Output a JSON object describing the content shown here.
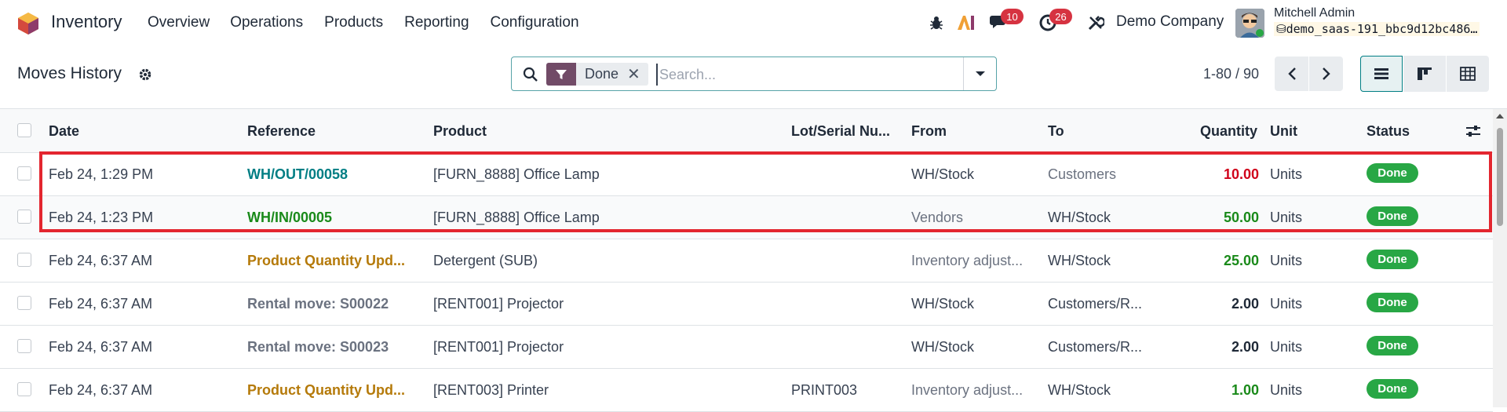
{
  "app": {
    "name": "Inventory"
  },
  "menu": [
    "Overview",
    "Operations",
    "Products",
    "Reporting",
    "Configuration"
  ],
  "systray": {
    "messages_badge": "10",
    "activities_badge": "26",
    "company": "Demo Company",
    "user_name": "Mitchell Admin",
    "db_name": "demo_saas-191_bbc9d12bc486…"
  },
  "page": {
    "title": "Moves History"
  },
  "search": {
    "facet": "Done",
    "placeholder": "Search..."
  },
  "pager": {
    "value": "1-80 / 90"
  },
  "columns": {
    "date": "Date",
    "reference": "Reference",
    "product": "Product",
    "lot": "Lot/Serial Nu...",
    "from": "From",
    "to": "To",
    "quantity": "Quantity",
    "unit": "Unit",
    "status": "Status"
  },
  "colors": {
    "accent": "#714b67",
    "teal": "#017e84",
    "done_green": "#28a745",
    "out_red": "#d0021b",
    "in_green": "#1a8a1a",
    "ref_blue": "#017e84",
    "ref_orange": "#b57a0a",
    "highlight": "#e3262f"
  },
  "rows": [
    {
      "date": "Feb 24, 1:29 PM",
      "reference": "WH/OUT/00058",
      "product": "[FURN_8888] Office Lamp",
      "lot": "",
      "from": "WH/Stock",
      "to": "Customers",
      "quantity": "10.00",
      "unit": "Units",
      "status": "Done"
    },
    {
      "date": "Feb 24, 1:23 PM",
      "reference": "WH/IN/00005",
      "product": "[FURN_8888] Office Lamp",
      "lot": "",
      "from": "Vendors",
      "to": "WH/Stock",
      "quantity": "50.00",
      "unit": "Units",
      "status": "Done"
    },
    {
      "date": "Feb 24, 6:37 AM",
      "reference": "Product Quantity Upd...",
      "product": "Detergent (SUB)",
      "lot": "",
      "from": "Inventory adjust...",
      "to": "WH/Stock",
      "quantity": "25.00",
      "unit": "Units",
      "status": "Done"
    },
    {
      "date": "Feb 24, 6:37 AM",
      "reference": "Rental move: S00022",
      "product": "[RENT001] Projector",
      "lot": "",
      "from": "WH/Stock",
      "to": "Customers/R...",
      "quantity": "2.00",
      "unit": "Units",
      "status": "Done"
    },
    {
      "date": "Feb 24, 6:37 AM",
      "reference": "Rental move: S00023",
      "product": "[RENT001] Projector",
      "lot": "",
      "from": "WH/Stock",
      "to": "Customers/R...",
      "quantity": "2.00",
      "unit": "Units",
      "status": "Done"
    },
    {
      "date": "Feb 24, 6:37 AM",
      "reference": "Product Quantity Upd...",
      "product": "[RENT003] Printer",
      "lot": "PRINT003",
      "from": "Inventory adjust...",
      "to": "WH/Stock",
      "quantity": "1.00",
      "unit": "Units",
      "status": "Done"
    }
  ]
}
